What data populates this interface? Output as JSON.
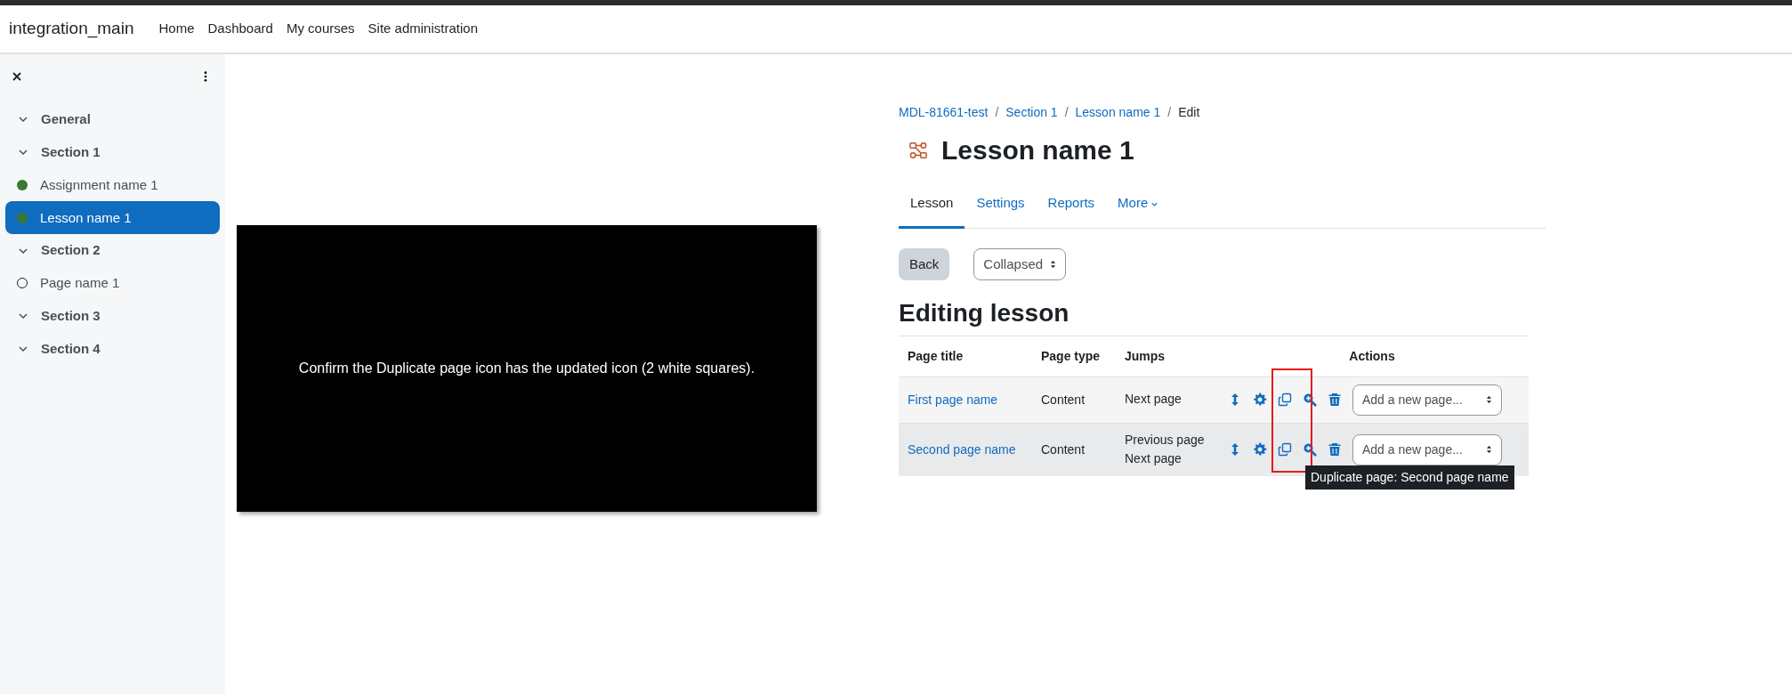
{
  "navbar": {
    "brand": "integration_main",
    "links": [
      "Home",
      "Dashboard",
      "My courses",
      "Site administration"
    ]
  },
  "sidebar": {
    "items": [
      {
        "kind": "section",
        "label": "General",
        "expanded": true
      },
      {
        "kind": "section",
        "label": "Section 1",
        "expanded": true
      },
      {
        "kind": "activity",
        "label": "Assignment name 1",
        "completed": true,
        "selected": false
      },
      {
        "kind": "activity",
        "label": "Lesson name 1",
        "completed": true,
        "selected": true
      },
      {
        "kind": "section",
        "label": "Section 2",
        "expanded": true
      },
      {
        "kind": "activity",
        "label": "Page name 1",
        "completed": false,
        "selected": false
      },
      {
        "kind": "section",
        "label": "Section 3",
        "expanded": true
      },
      {
        "kind": "section",
        "label": "Section 4",
        "expanded": true
      }
    ]
  },
  "note_panel": {
    "text": "Confirm the Duplicate page icon has the updated icon (2 white squares)."
  },
  "breadcrumb": [
    "MDL-81661-test",
    "Section 1",
    "Lesson name 1",
    "Edit"
  ],
  "breadcrumb_separator": "/",
  "title": "Lesson name 1",
  "tabs": [
    {
      "label": "Lesson",
      "selected": true,
      "kind": "link"
    },
    {
      "label": "Settings",
      "selected": false,
      "kind": "link"
    },
    {
      "label": "Reports",
      "selected": false,
      "kind": "link"
    },
    {
      "label": "More",
      "selected": false,
      "kind": "dropdown"
    }
  ],
  "back_button": "Back",
  "view_select": {
    "value": "Collapsed"
  },
  "section_heading": "Editing lesson",
  "table": {
    "columns": [
      "Page title",
      "Page type",
      "Jumps",
      "Actions"
    ],
    "rows": [
      {
        "page_title": "First page name",
        "page_type": "Content",
        "jumps": [
          "Next page"
        ],
        "hovered": false,
        "add_page": {
          "placeholder": "Add a new page..."
        }
      },
      {
        "page_title": "Second page name",
        "page_type": "Content",
        "jumps": [
          "Previous page",
          "Next page"
        ],
        "hovered": true,
        "add_page": {
          "placeholder": "Add a new page..."
        }
      }
    ]
  },
  "tooltip": {
    "text": "Duplicate page: Second page name"
  }
}
